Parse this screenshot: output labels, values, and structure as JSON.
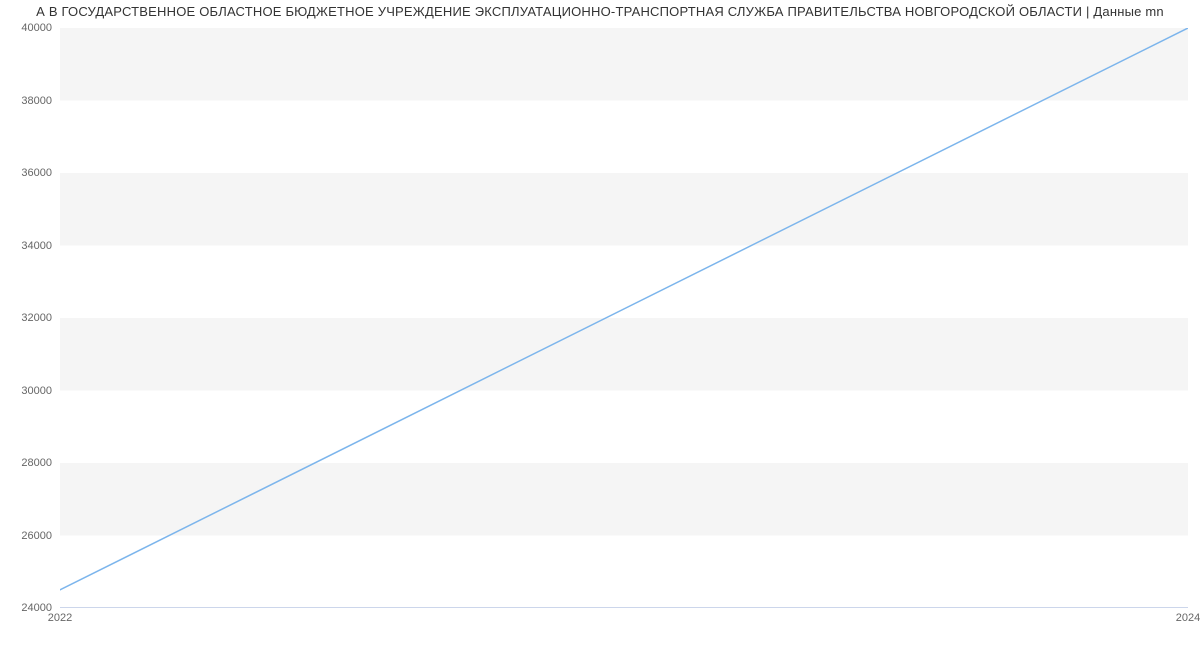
{
  "chart_data": {
    "type": "line",
    "title": "А В ГОСУДАРСТВЕННОЕ ОБЛАСТНОЕ БЮДЖЕТНОЕ УЧРЕЖДЕНИЕ ЭКСПЛУАТАЦИОННО-ТРАНСПОРТНАЯ СЛУЖБА  ПРАВИТЕЛЬСТВА НОВГОРОДСКОЙ ОБЛАСТИ | Данные mn",
    "x": [
      2022,
      2024
    ],
    "series": [
      {
        "name": "value",
        "values": [
          24500,
          40000
        ]
      }
    ],
    "xlabel": "",
    "ylabel": "",
    "xlim": [
      2022,
      2024
    ],
    "ylim": [
      24000,
      40000
    ],
    "x_ticks": [
      2022,
      2024
    ],
    "y_ticks": [
      24000,
      26000,
      28000,
      30000,
      32000,
      34000,
      36000,
      38000,
      40000
    ],
    "line_color": "#7cb5ec",
    "band_color": "#f5f5f5"
  }
}
